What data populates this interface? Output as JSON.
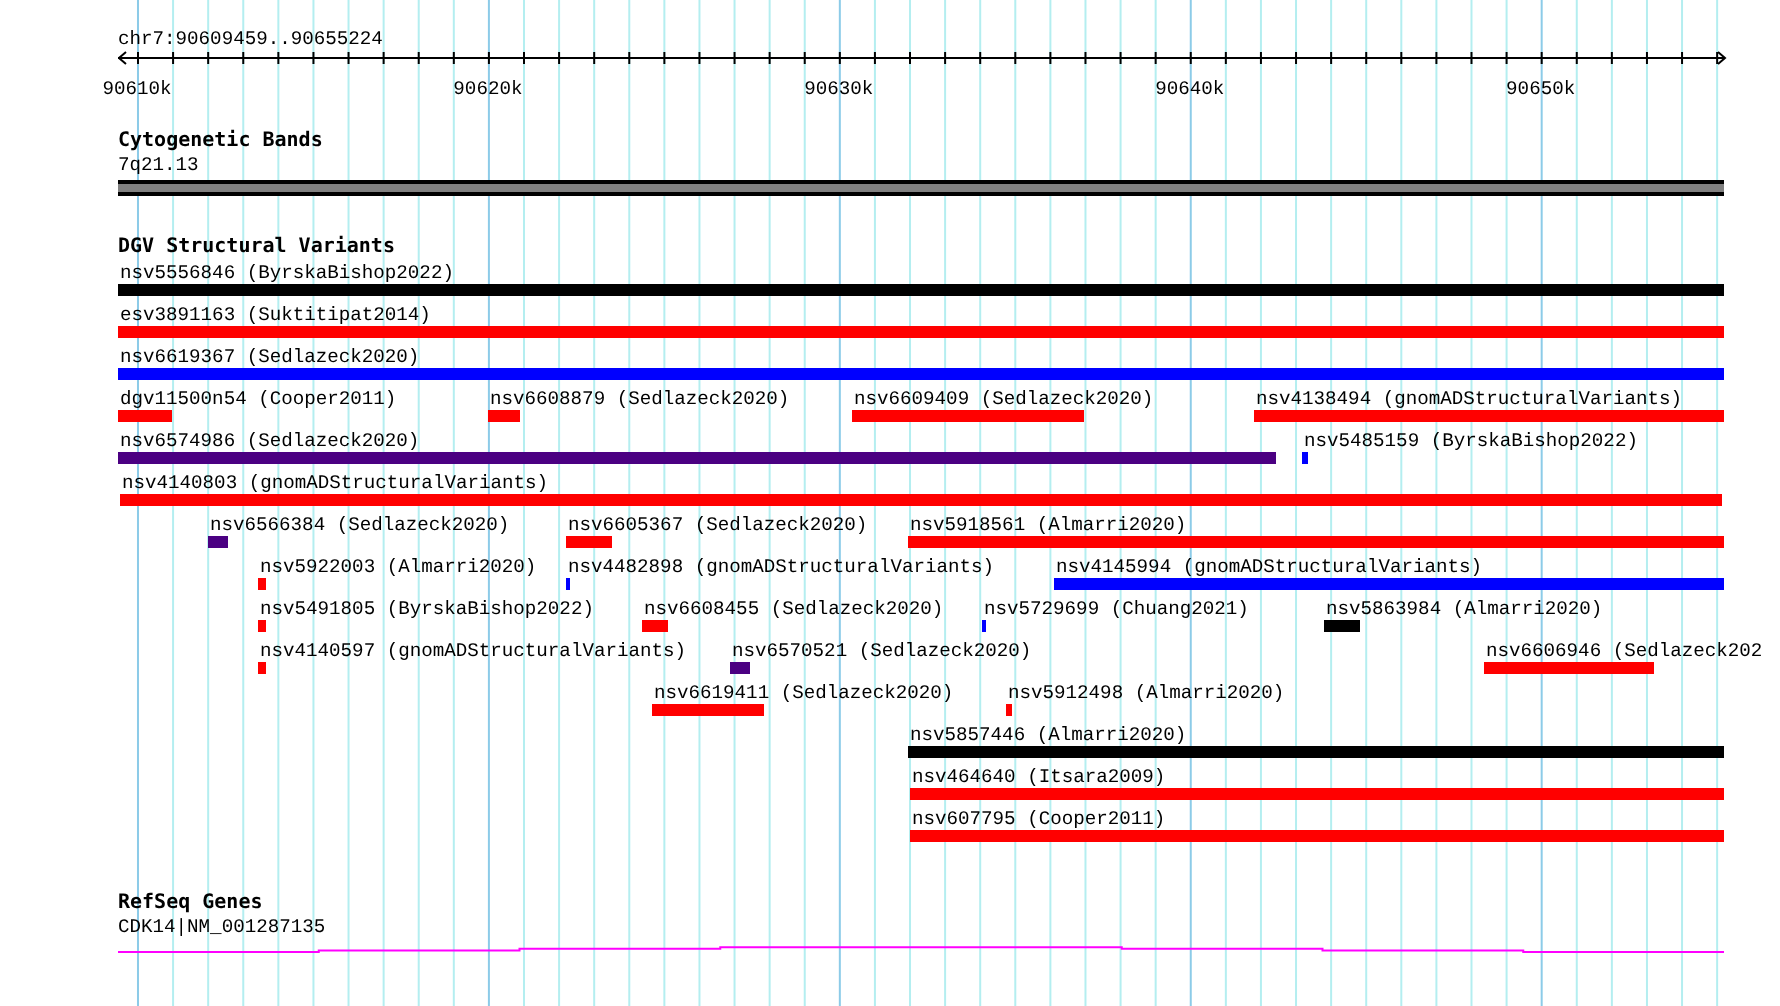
{
  "region": {
    "label": "chr7:90609459..90655224"
  },
  "ruler": {
    "ticks": [
      "90610k",
      "90620k",
      "90630k",
      "90640k",
      "90650k"
    ]
  },
  "cytogenetic_bands": {
    "title": "Cytogenetic Bands",
    "band": {
      "label": "7q21.13"
    }
  },
  "dgv_structural_variants": {
    "title": "DGV Structural Variants",
    "variants": [
      {
        "label": "nsv5556846 (ByrskaBishop2022)",
        "color": "#000000"
      },
      {
        "label": "esv3891163 (Suktitipat2014)",
        "color": "#ff0000"
      },
      {
        "label": "nsv6619367 (Sedlazeck2020)",
        "color": "#0000ff"
      },
      {
        "label": "dgv11500n54 (Cooper2011)",
        "color": "#ff0000"
      },
      {
        "label": "nsv6608879 (Sedlazeck2020)",
        "color": "#ff0000"
      },
      {
        "label": "nsv6609409 (Sedlazeck2020)",
        "color": "#ff0000"
      },
      {
        "label": "nsv4138494 (gnomADStructuralVariants)",
        "color": "#ff0000"
      },
      {
        "label": "nsv6574986 (Sedlazeck2020)",
        "color": "#4b0082"
      },
      {
        "label": "nsv5485159 (ByrskaBishop2022)",
        "color": "#0000ff"
      },
      {
        "label": "nsv4140803 (gnomADStructuralVariants)",
        "color": "#ff0000"
      },
      {
        "label": "nsv6566384 (Sedlazeck2020)",
        "color": "#4b0082"
      },
      {
        "label": "nsv6605367 (Sedlazeck2020)",
        "color": "#ff0000"
      },
      {
        "label": "nsv5918561 (Almarri2020)",
        "color": "#ff0000"
      },
      {
        "label": "nsv5922003 (Almarri2020)",
        "color": "#ff0000"
      },
      {
        "label": "nsv4482898 (gnomADStructuralVariants)",
        "color": "#0000ff"
      },
      {
        "label": "nsv4145994 (gnomADStructuralVariants)",
        "color": "#0000ff"
      },
      {
        "label": "nsv5491805 (ByrskaBishop2022)",
        "color": "#ff0000"
      },
      {
        "label": "nsv6608455 (Sedlazeck2020)",
        "color": "#ff0000"
      },
      {
        "label": "nsv5729699 (Chuang2021)",
        "color": "#0000ff"
      },
      {
        "label": "nsv5863984 (Almarri2020)",
        "color": "#000000"
      },
      {
        "label": "nsv4140597 (gnomADStructuralVariants)",
        "color": "#ff0000"
      },
      {
        "label": "nsv6570521 (Sedlazeck2020)",
        "color": "#4b0082"
      },
      {
        "label": "nsv6606946 (Sedlazeck202",
        "color": "#ff0000"
      },
      {
        "label": "nsv6619411 (Sedlazeck2020)",
        "color": "#ff0000"
      },
      {
        "label": "nsv5912498 (Almarri2020)",
        "color": "#ff0000"
      },
      {
        "label": "nsv5857446 (Almarri2020)",
        "color": "#000000"
      },
      {
        "label": "nsv464640 (Itsara2009)",
        "color": "#ff0000"
      },
      {
        "label": "nsv607795 (Cooper2011)",
        "color": "#ff0000"
      }
    ]
  },
  "refseq_genes": {
    "title": "RefSeq Genes",
    "gene": {
      "label": "CDK14|NM_001287135"
    }
  }
}
